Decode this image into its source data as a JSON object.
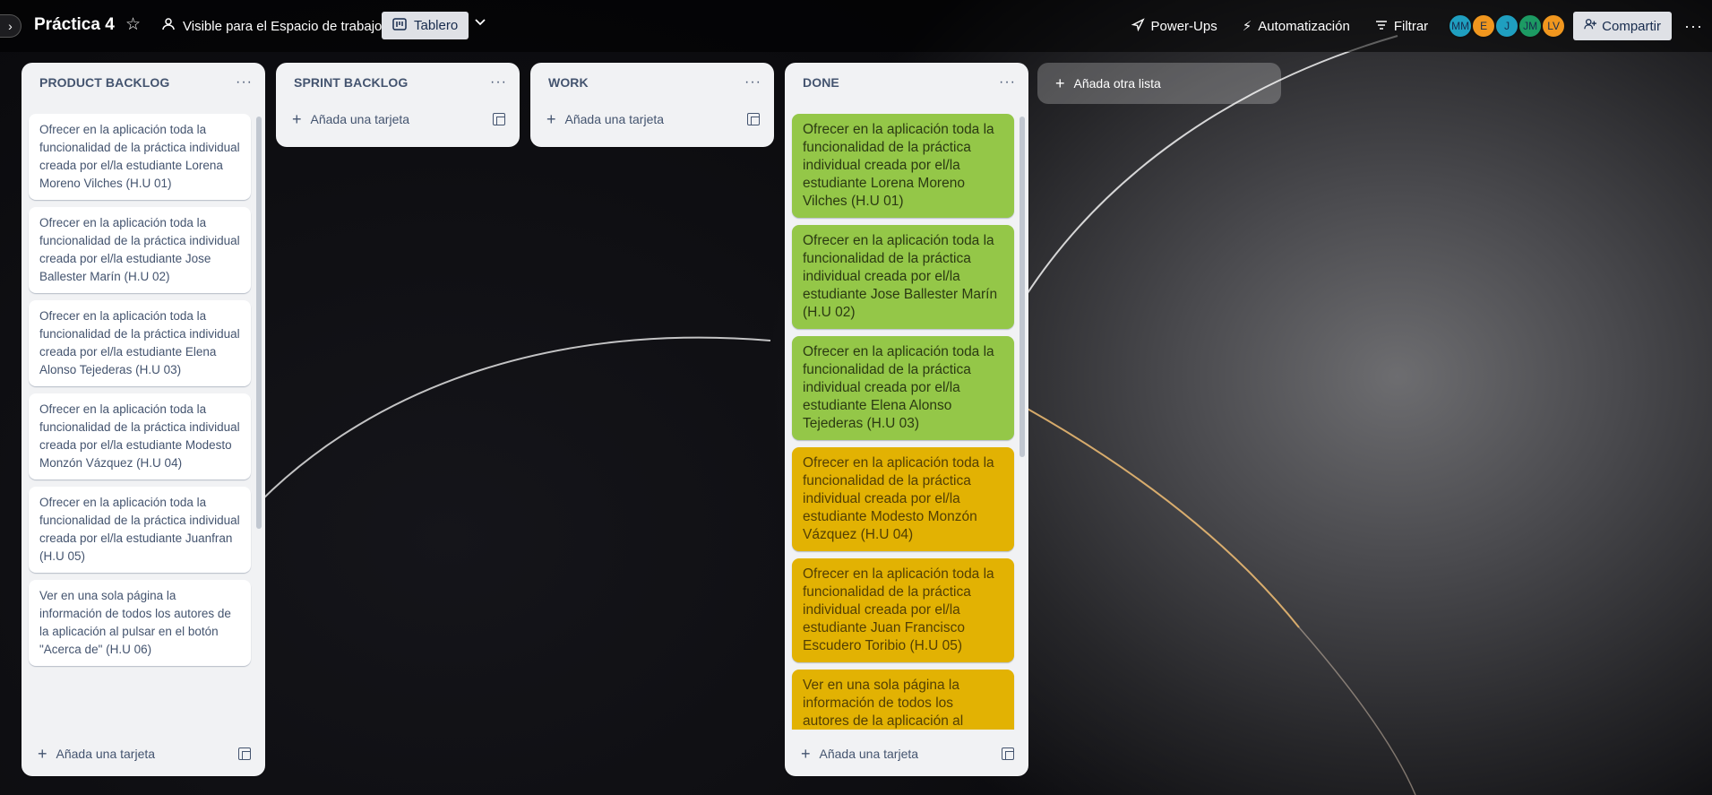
{
  "topbar": {
    "board_title": "Práctica 4",
    "visibility": "Visible para el Espacio de trabajo",
    "view_label": "Tablero",
    "actions": {
      "power_ups": "Power-Ups",
      "automation": "Automatización",
      "filter": "Filtrar",
      "share": "Compartir"
    },
    "avatars": [
      {
        "initials": "MM",
        "color": "#1f9fc0"
      },
      {
        "initials": "E",
        "color": "#f0961e"
      },
      {
        "initials": "J",
        "color": "#1f9fc0"
      },
      {
        "initials": "JM",
        "color": "#1c9a63"
      },
      {
        "initials": "LV",
        "color": "#f0961e"
      }
    ]
  },
  "lists": {
    "product_backlog": {
      "title": "PRODUCT BACKLOG",
      "cards": [
        "Ofrecer en la aplicación toda la funcionalidad de la práctica individual creada por el/la estudiante Lorena Moreno Vilches (H.U 01)",
        "Ofrecer en la aplicación toda la funcionalidad de la práctica individual creada por el/la estudiante Jose Ballester Marín (H.U 02)",
        "Ofrecer en la aplicación toda la funcionalidad de la práctica individual creada por el/la estudiante Elena Alonso Tejederas (H.U 03)",
        "Ofrecer en la aplicación toda la funcionalidad de la práctica individual creada por el/la estudiante Modesto Monzón Vázquez (H.U 04)",
        "Ofrecer en la aplicación toda la funcionalidad de la práctica individual creada por el/la estudiante Juanfran (H.U 05)",
        "Ver en una sola página la información de todos los autores de la aplicación al pulsar en el botón \"Acerca de\" (H.U 06)"
      ],
      "add_card": "Añada una tarjeta"
    },
    "sprint_backlog": {
      "title": "SPRINT BACKLOG",
      "add_card": "Añada una tarjeta"
    },
    "work": {
      "title": "WORK",
      "add_card": "Añada una tarjeta"
    },
    "done": {
      "title": "DONE",
      "cards": [
        {
          "text": "Ofrecer en la aplicación toda la funcionalidad de la práctica individual creada por el/la estudiante Lorena Moreno Vilches (H.U 01)",
          "label": "green"
        },
        {
          "text": "Ofrecer en la aplicación toda la funcionalidad de la práctica individual creada por el/la estudiante Jose Ballester Marín (H.U 02)",
          "label": "green"
        },
        {
          "text": "Ofrecer en la aplicación toda la funcionalidad de la práctica individual creada por el/la estudiante Elena Alonso Tejederas (H.U 03)",
          "label": "green"
        },
        {
          "text": "Ofrecer en la aplicación toda la funcionalidad de la práctica individual creada por el/la estudiante Modesto Monzón Vázquez (H.U 04)",
          "label": "yellow"
        },
        {
          "text": "Ofrecer en la aplicación toda la funcionalidad de la práctica individual creada por el/la estudiante Juan Francisco Escudero Toribio (H.U 05)",
          "label": "yellow"
        },
        {
          "text": "Ver en una sola página la información de todos los autores de la aplicación al pulsar en el botón \"Acerca de\"",
          "label": "yellow"
        }
      ],
      "add_card": "Añada una tarjeta"
    }
  },
  "add_list": "Añada otra lista",
  "colors": {
    "label_green": "#94c748",
    "label_yellow": "#e2b203",
    "list_bg": "#f1f2f4"
  }
}
